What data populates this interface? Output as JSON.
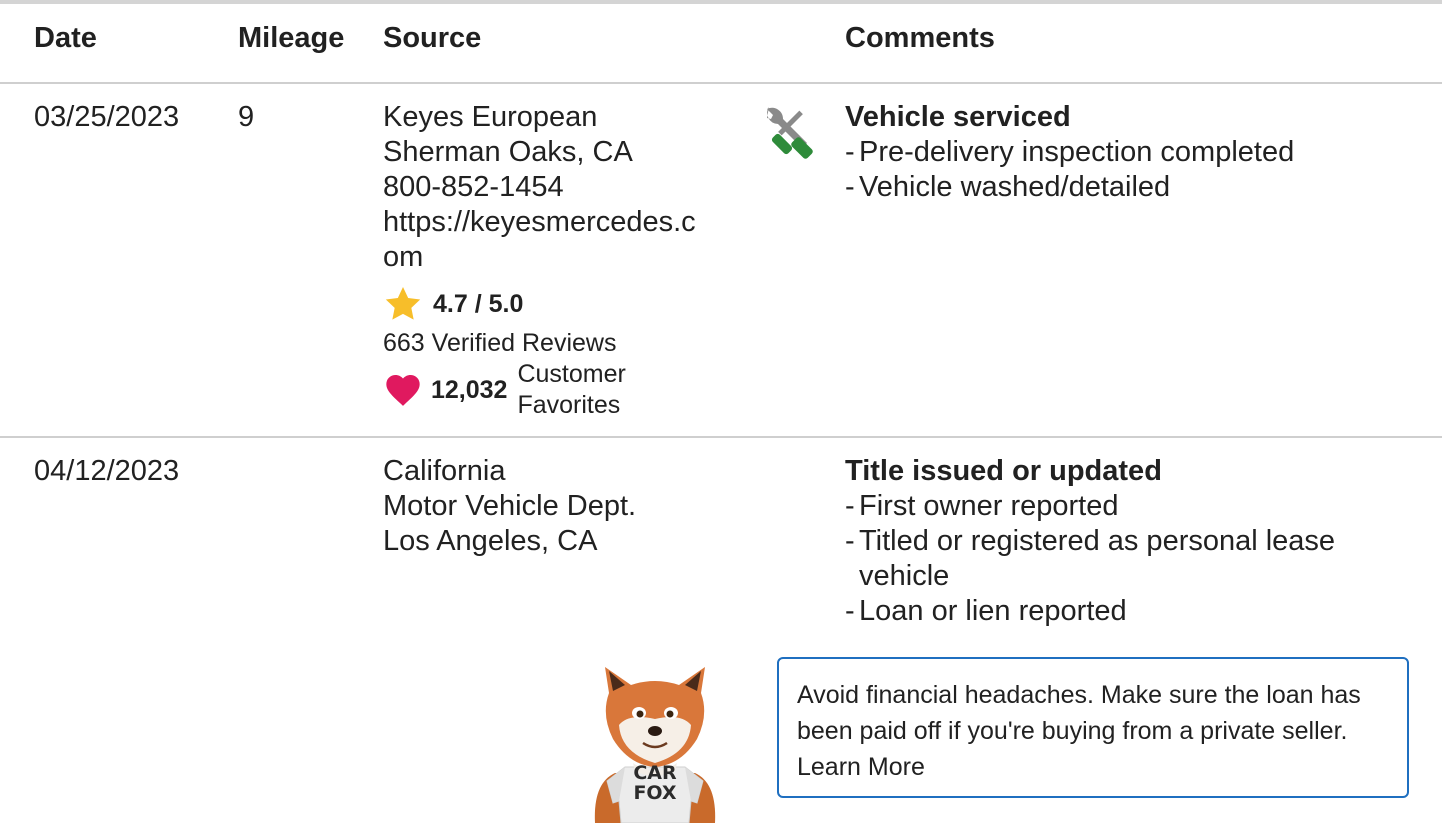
{
  "table": {
    "headers": {
      "date": "Date",
      "mileage": "Mileage",
      "source": "Source",
      "comments": "Comments"
    },
    "rows": [
      {
        "date": "03/25/2023",
        "mileage": "9",
        "source": {
          "line1": "Keyes European",
          "line2": "Sherman Oaks, CA",
          "phone": "800-852-1454",
          "url_part1": "https://keyesmercedes.c",
          "url_part2": "om",
          "rating": "4.7 / 5.0",
          "reviews": "663 Verified Reviews",
          "favorites_count": "12,032",
          "favorites_label_1": "Customer",
          "favorites_label_2": "Favorites"
        },
        "icon": "service-tools-icon",
        "comment_title": "Vehicle serviced",
        "comment_items": [
          "Pre-delivery inspection completed",
          "Vehicle washed/detailed"
        ]
      },
      {
        "date": "04/12/2023",
        "mileage": "",
        "source": {
          "line1": "California",
          "line2": "Motor Vehicle Dept.",
          "line3": "Los Angeles, CA"
        },
        "comment_title": "Title issued or updated",
        "comment_items": [
          "First owner reported",
          "Titled or registered as personal lease vehicle",
          "Loan or lien reported"
        ]
      }
    ]
  },
  "tip": {
    "text": "Avoid financial headaches. Make sure the loan has been paid off if you're buying from a private seller.",
    "link": "Learn More"
  },
  "mascot": {
    "shirt_line1": "CAR",
    "shirt_line2": "FOX"
  },
  "colors": {
    "star": "#F7BE2A",
    "heart": "#E0195F",
    "tip_border": "#1F6FC0",
    "wrench_green": "#2E8B3A"
  }
}
